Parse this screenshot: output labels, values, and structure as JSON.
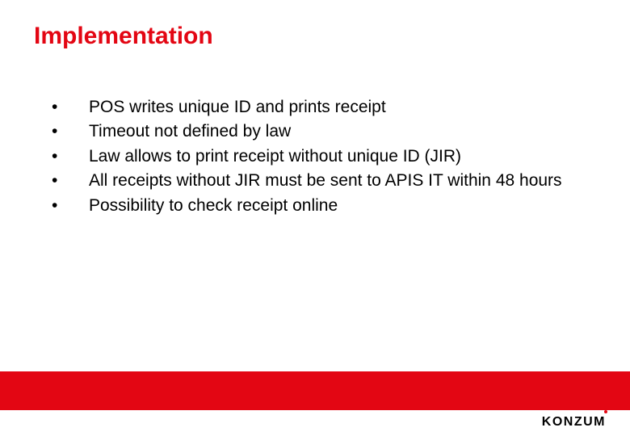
{
  "title": "Implementation",
  "bullets": [
    "POS writes unique ID and prints receipt",
    "Timeout not defined by law",
    "Law allows to print receipt without unique ID (JIR)",
    "All receipts without JIR must be sent to APIS IT within 48 hours",
    "Possibility to check receipt online"
  ],
  "brand": {
    "name": "KONZUM",
    "accent": "#e30613"
  }
}
